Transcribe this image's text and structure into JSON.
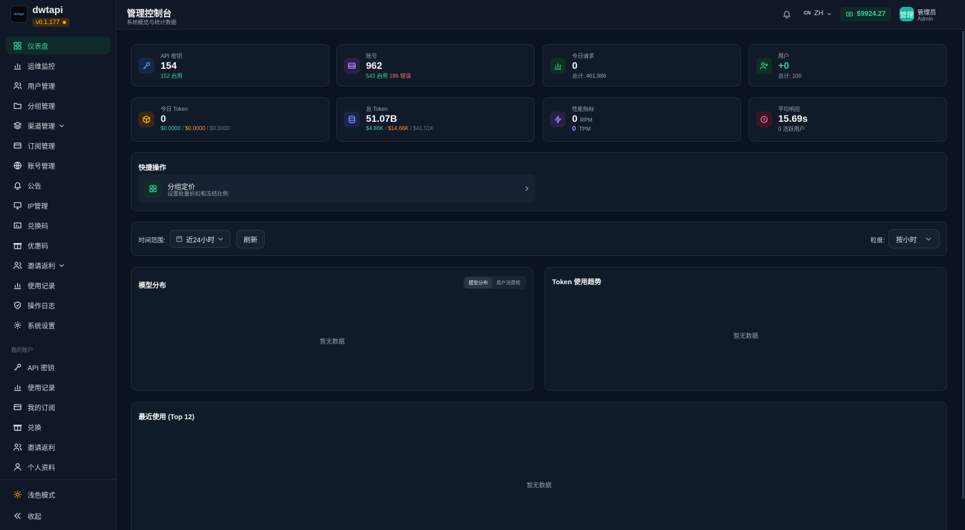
{
  "brand": {
    "logo_text": "dwtapi",
    "name": "dwtapi",
    "version": "v0.1.177"
  },
  "sidebar": {
    "items": [
      {
        "label": "仪表盘",
        "icon": "grid-icon"
      },
      {
        "label": "运维监控",
        "icon": "bar-chart-icon"
      },
      {
        "label": "用户管理",
        "icon": "users-icon"
      },
      {
        "label": "分组管理",
        "icon": "folder-icon"
      },
      {
        "label": "渠道管理",
        "icon": "layers-icon"
      },
      {
        "label": "订阅管理",
        "icon": "card-icon"
      },
      {
        "label": "账号管理",
        "icon": "globe-icon"
      },
      {
        "label": "公告",
        "icon": "bell-icon"
      },
      {
        "label": "IP管理",
        "icon": "monitor-icon"
      },
      {
        "label": "兑换码",
        "icon": "ticket-icon"
      },
      {
        "label": "优惠码",
        "icon": "gift-icon"
      },
      {
        "label": "邀请返利",
        "icon": "users-icon"
      },
      {
        "label": "使用记录",
        "icon": "bar-chart-icon"
      },
      {
        "label": "操作日志",
        "icon": "shield-icon"
      },
      {
        "label": "系统设置",
        "icon": "gear-icon"
      }
    ],
    "section_label": "我的账户",
    "account_items": [
      {
        "label": "API 密钥",
        "icon": "key-icon"
      },
      {
        "label": "使用记录",
        "icon": "bar-chart-icon"
      },
      {
        "label": "我的订阅",
        "icon": "card-icon"
      },
      {
        "label": "兑换",
        "icon": "gift-icon"
      },
      {
        "label": "邀请返利",
        "icon": "users-icon"
      },
      {
        "label": "个人资料",
        "icon": "user-icon"
      }
    ],
    "theme_toggle": "浅色模式",
    "collapse": "收起"
  },
  "header": {
    "title": "管理控制台",
    "subtitle": "系统概览与统计数据",
    "lang_code": "CN",
    "lang": "ZH",
    "balance": "$9924.27",
    "avatar_text": "管理",
    "user_name": "管理员",
    "user_role": "Admin"
  },
  "stats": {
    "api_keys": {
      "label": "API 密钥",
      "value": "154",
      "sub": "152 启用"
    },
    "accounts": {
      "label": "账号",
      "value": "962",
      "sub_ok": "543 启用",
      "sub_err": "196 错误"
    },
    "today_requests": {
      "label": "今日请求",
      "value": "0",
      "sub": "总计: 461,986"
    },
    "users": {
      "label": "用户",
      "value": "+0",
      "sub": "总计: 100"
    },
    "today_token": {
      "label": "今日 Token",
      "value": "0",
      "sub_a": "$0.0000",
      "sep1": " / ",
      "sub_b": "$0.0000",
      "sep2": " / ",
      "sub_c": "$0.0000"
    },
    "total_token": {
      "label": "总 Token",
      "value": "51.07B",
      "sub_a": "$4.86K",
      "sep1": " / ",
      "sub_b": "$14.66K",
      "sep2": " / ",
      "sub_c": "$41.51K"
    },
    "performance": {
      "label": "性能指标",
      "rpm_value": "0",
      "rpm_unit": "RPM",
      "tpm_value": "0",
      "tpm_unit": "TPM"
    },
    "avg_response": {
      "label": "平均响应",
      "value": "15.69s",
      "sub": "0 活跃用户"
    }
  },
  "quick_actions": {
    "title": "快捷操作",
    "items": [
      {
        "title": "分组定价",
        "desc": "设置批量折扣和冻结比例"
      }
    ]
  },
  "filters": {
    "time_label": "时间范围:",
    "time_value": "近24小时",
    "refresh": "刷新",
    "granularity_label": "粒度:",
    "granularity_value": "按小时"
  },
  "model_dist": {
    "title": "模型分布",
    "tabs": [
      "模型分布",
      "用户消费榜"
    ],
    "empty": "暂无数据"
  },
  "token_trend": {
    "title": "Token 使用趋势",
    "empty": "暂无数据"
  },
  "recent_usage": {
    "title": "最近使用 (Top 12)",
    "empty": "暂无数据"
  },
  "colors": {
    "accent": "#34d399",
    "background": "#0b1220",
    "card": "#111a28",
    "error": "#f87171",
    "warning": "#fb923c"
  }
}
